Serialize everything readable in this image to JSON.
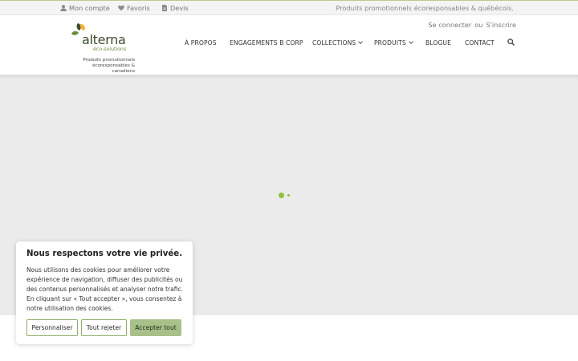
{
  "topbar": {
    "account_label": "Mon compte",
    "account_icon": "user-icon",
    "favorites_label": "Favoris",
    "favorites_icon": "heart-icon",
    "quote_label": "Devis",
    "quote_icon": "document-icon",
    "tagline": "Produits promotionnels écoresponsables & québécois."
  },
  "auth": {
    "login": "Se connecter",
    "separator": "ou",
    "register": "S'inscrire"
  },
  "logo": {
    "word": "alterna",
    "eco": "éco-solutions",
    "sub_line1": "Produits promotionnels",
    "sub_line2": "écoresponsables & canadiens"
  },
  "nav": {
    "items": [
      {
        "label": "À PROPOS",
        "has_dropdown": false
      },
      {
        "label": "ENGAGEMENTS B CORP",
        "has_dropdown": false
      },
      {
        "label": "COLLECTIONS",
        "has_dropdown": true
      },
      {
        "label": "PRODUITS",
        "has_dropdown": true
      },
      {
        "label": "BLOGUE",
        "has_dropdown": false
      },
      {
        "label": "CONTACT",
        "has_dropdown": false
      }
    ],
    "search_icon": "search-icon"
  },
  "cookie": {
    "title": "Nous respectons votre vie privée.",
    "text": "Nous utilisons des cookies pour améliorer votre expérience de navigation, diffuser des publicités ou des contenus personnalisés et analyser notre trafic. En cliquant sur « Tout accepter », vous consentez à notre utilisation des cookies.",
    "customize": "Personnaliser",
    "reject": "Tout rejeter",
    "accept": "Accepter tout"
  },
  "colors": {
    "accent": "#8fc13c",
    "button_fill": "#a8c08a",
    "hero_bg": "#ebebeb"
  }
}
